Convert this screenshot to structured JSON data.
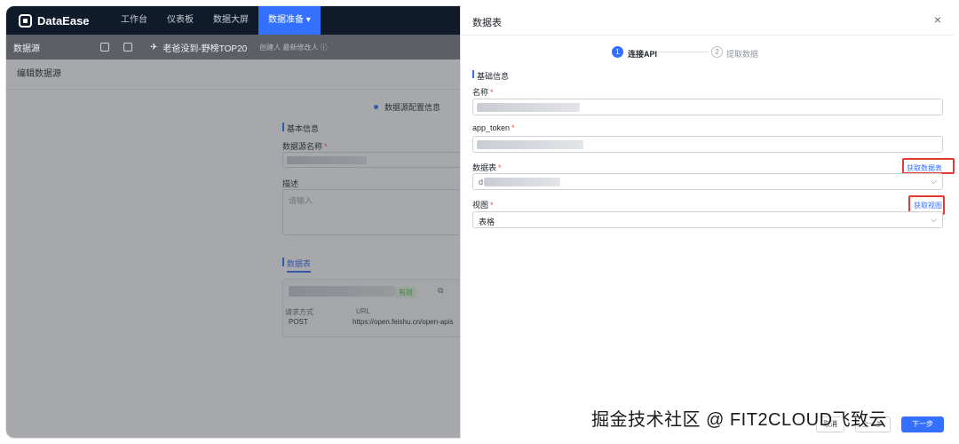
{
  "app": {
    "logo_text": "DataEase",
    "nav": [
      "工作台",
      "仪表板",
      "数据大屏",
      "数据准备 ▾"
    ]
  },
  "subbar": {
    "title": "数据源",
    "doc_name": "老爸没到-野榜TOP20",
    "doc_meta": "创建人 最新修改人 ⓘ"
  },
  "edit": {
    "header": "编辑数据源",
    "step_label": "数据源配置信息",
    "basic_info": "基本信息",
    "ds_name_label": "数据源名称",
    "desc_label": "描述",
    "desc_placeholder": "请输入",
    "tab_label": "数据表",
    "card_status": "有效",
    "req_method_label": "请求方式",
    "req_method_value": "POST",
    "url_label": "URL",
    "url_value": "https://open.feishu.cn/open-apis"
  },
  "drawer": {
    "title": "数据表",
    "close_icon": "×",
    "steps": [
      {
        "num": "1",
        "label": "连接API"
      },
      {
        "num": "2",
        "label": "提取数据"
      }
    ],
    "section": "基础信息",
    "name_label": "名称",
    "token_label": "app_token",
    "table_label": "数据表",
    "table_value_prefix": "d",
    "fetch_table": "获取数据表",
    "view_label": "视图",
    "view_value": "表格",
    "fetch_view": "获取视图",
    "btn_cancel": "取消",
    "btn_prev": "上一步",
    "btn_next": "下一步"
  },
  "watermark": "掘金技术社区 @ FIT2CLOUD飞致云",
  "colors": {
    "primary": "#3370ff",
    "nav_bg": "#0f1a2b",
    "highlight": "#e53935",
    "valid": "#34c724"
  }
}
